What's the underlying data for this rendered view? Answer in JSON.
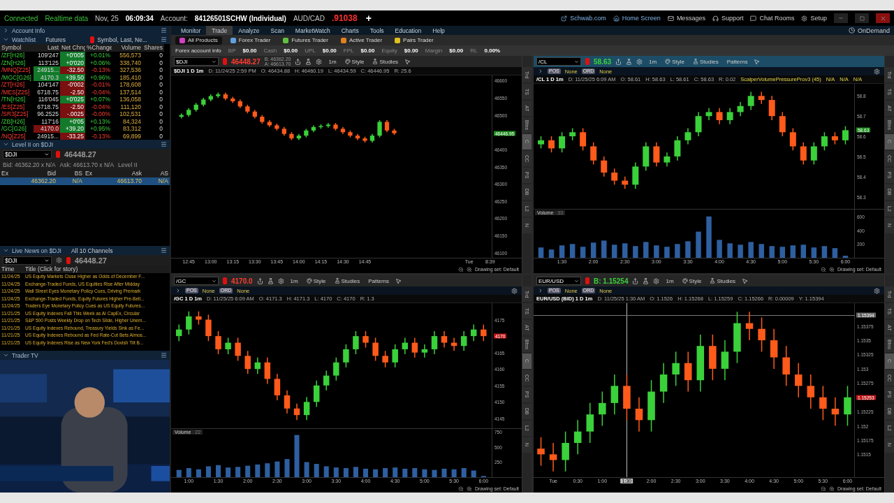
{
  "top_bar": {
    "status": [
      "Connected",
      "Realtime data"
    ],
    "date": "Nov, 25",
    "time": "06:09:34",
    "account_label": "Account:",
    "account": "84126501SCHW (Individual)",
    "symbol": "AUD/CAD",
    "price": ".91038",
    "add": "+",
    "links": [
      {
        "label": "Schwab.com",
        "kind": "external"
      },
      {
        "label": "Home Screen",
        "kind": "home"
      },
      {
        "label": "Messages",
        "kind": "mail"
      },
      {
        "label": "Support",
        "kind": "support"
      },
      {
        "label": "Chat Rooms",
        "kind": "chat"
      },
      {
        "label": "Setup",
        "kind": "setup"
      }
    ]
  },
  "sidebar": {
    "account_header": "Account Info",
    "watchlist": {
      "title": "Watchlist",
      "list": "Futures",
      "columns_menu": "Symbol, Last, Ne...",
      "columns": [
        "Symbol",
        "Last",
        "Net Chng",
        "%Change",
        "Volume",
        "Shares"
      ],
      "rows": [
        {
          "symbol": "/ZF[H26]",
          "last": "109'247",
          "net": "+0'005",
          "pct": "+0.01%",
          "volume": "556,573",
          "shares": "0",
          "rising": true,
          "last_up_tick": false,
          "last_down_tick": false
        },
        {
          "symbol": "/ZN[H26]",
          "last": "113'125",
          "net": "+0'020",
          "pct": "+0.06%",
          "volume": "338,740",
          "shares": "0",
          "rising": true,
          "last_up_tick": false,
          "last_down_tick": false
        },
        {
          "symbol": "/MNQ[Z25]",
          "last": "24915...",
          "net": "-32.50",
          "pct": "-0.13%",
          "volume": "327,536",
          "shares": "0",
          "rising": false,
          "last_up_tick": true,
          "last_down_tick": false
        },
        {
          "symbol": "/MGC[G26]",
          "last": "4170.3",
          "net": "+39.50",
          "pct": "+0.96%",
          "volume": "185,410",
          "shares": "0",
          "rising": true,
          "last_up_tick": true,
          "last_down_tick": false
        },
        {
          "symbol": "/ZT[H26]",
          "last": "104'147",
          "net": "-0'002",
          "pct": "-0.01%",
          "volume": "178,608",
          "shares": "0",
          "rising": false,
          "last_up_tick": false,
          "last_down_tick": false
        },
        {
          "symbol": "/MES[Z25]",
          "last": "6718.75",
          "net": "-2.50",
          "pct": "-0.04%",
          "volume": "137,514",
          "shares": "0",
          "rising": false,
          "last_up_tick": false,
          "last_down_tick": false
        },
        {
          "symbol": "/TN[H26]",
          "last": "116'045",
          "net": "+0'025",
          "pct": "+0.07%",
          "volume": "136,058",
          "shares": "0",
          "rising": true,
          "last_up_tick": false,
          "last_down_tick": false
        },
        {
          "symbol": "/ES[Z25]",
          "last": "6718.75",
          "net": "-2.50",
          "pct": "-0.04%",
          "volume": "111,120",
          "shares": "0",
          "rising": false,
          "last_up_tick": false,
          "last_down_tick": false
        },
        {
          "symbol": "/SR3[Z25]",
          "last": "96.2525",
          "net": "-.0025",
          "pct": "-0.00%",
          "volume": "102,531",
          "shares": "0",
          "rising": false,
          "last_up_tick": false,
          "last_down_tick": false
        },
        {
          "symbol": "/ZB[H26]",
          "last": "117'16",
          "net": "+0'05",
          "pct": "+0.13%",
          "volume": "84,324",
          "shares": "0",
          "rising": true,
          "last_up_tick": false,
          "last_down_tick": false
        },
        {
          "symbol": "/GC[G26]",
          "last": "4170.0",
          "net": "+39.20",
          "pct": "+0.95%",
          "volume": "83,312",
          "shares": "0",
          "rising": true,
          "last_up_tick": false,
          "last_down_tick": true
        },
        {
          "symbol": "/NQ[Z25]",
          "last": "24915...",
          "net": "-33.25",
          "pct": "-0.13%",
          "volume": "69,899",
          "shares": "0",
          "rising": false,
          "last_up_tick": false,
          "last_down_tick": false
        }
      ]
    },
    "level2": {
      "title": "Level II on $DJI",
      "symbol": "$DJI",
      "price": "46448.27",
      "bid": "Bid: 46362.20 x N/A",
      "ask": "Ask: 46613.70 x N/A",
      "mode": "Level II",
      "columns": [
        "Ex",
        "Bid",
        "BS",
        "Ex",
        "Ask",
        "AS"
      ],
      "rows": [
        [
          "",
          "46362.20",
          "N/A",
          "",
          "46613.70",
          "N/A"
        ]
      ]
    },
    "news": {
      "title": "Live News on $DJI",
      "channels": "All 10 Channels",
      "symbol": "$DJI",
      "price": "46448.27",
      "columns": [
        "Time",
        "Title (Click for story)"
      ],
      "rows": [
        [
          "11/24/25",
          "US Equity Markets Close Higher as Odds of December F..."
        ],
        [
          "11/24/25",
          "Exchange-Traded Funds, US Equities Rise After Midday"
        ],
        [
          "11/24/25",
          "Wall Street Eyes Monetary Policy Cues, Driving Premark"
        ],
        [
          "11/24/25",
          "Exchange-Traded Funds, Equity Futures Higher Pre-Bell..."
        ],
        [
          "11/24/25",
          "Traders Eye Monetary Policy Cues as US Equity Futures..."
        ],
        [
          "11/21/25",
          "US Equity Indexes Fall This Week as AI CapEx, Circular"
        ],
        [
          "11/21/25",
          "S&P 500 Posts Weekly Drop on Tech Slide, Higher Unem..."
        ],
        [
          "11/21/25",
          "US Equity Indexes Rebound, Treasury Yields Sink as Fe..."
        ],
        [
          "11/21/25",
          "US Equity Indexes Rebound as Fed Rate-Cut Bets Almos..."
        ],
        [
          "11/21/25",
          "US Equity Indexes Rise as New York Fed's Dovish Tilt B..."
        ]
      ]
    },
    "tv": {
      "title": "Trader TV"
    }
  },
  "menu": {
    "tabs": [
      {
        "label": "Monitor",
        "selected": false
      },
      {
        "label": "Trade",
        "selected": true
      },
      {
        "label": "Analyze",
        "selected": false
      },
      {
        "label": "Scan",
        "selected": false
      },
      {
        "label": "MarketWatch",
        "selected": false
      },
      {
        "label": "Charts",
        "selected": false
      },
      {
        "label": "Tools",
        "selected": false
      },
      {
        "label": "Education",
        "selected": false
      },
      {
        "label": "Help",
        "selected": false
      }
    ],
    "on_demand": "OnDemand"
  },
  "product_tabs": [
    {
      "label": "All Products",
      "selected": true,
      "color": "#d040c0"
    },
    {
      "label": "Forex Trader",
      "selected": false,
      "color": "#60a0e0"
    },
    {
      "label": "Futures Trader",
      "selected": false,
      "color": "#60c040"
    },
    {
      "label": "Active Trader",
      "selected": false,
      "color": "#e08020"
    },
    {
      "label": "Pairs Trader",
      "selected": false,
      "color": "#e0c020"
    }
  ],
  "account_info": {
    "title": "Forex account info",
    "fields": [
      {
        "label": "BP",
        "value": "$0.00"
      },
      {
        "label": "Cash",
        "value": "$0.00"
      },
      {
        "label": "UPL",
        "value": "$0.00"
      },
      {
        "label": "FPL",
        "value": "$0.00"
      },
      {
        "label": "Equity",
        "value": "$0.00"
      },
      {
        "label": "Margin",
        "value": "$0.00"
      },
      {
        "label": "RL",
        "value": "0.00%"
      }
    ]
  },
  "charts": [
    {
      "symbol": "$DJI",
      "price": "46448.27",
      "price_up": false,
      "quote": [
        "B: 46362.20",
        "A: 46613.70"
      ],
      "active": false,
      "buttons": [
        "1m",
        "Style",
        "Studies"
      ],
      "info": {
        "title": "$DJI 1 D 1m",
        "fields": [
          "D: 11/24/25 2:59 PM",
          "O: 46434.88",
          "H: 46460.19",
          "L: 46434.59",
          "C: 46446.95",
          "R: 25.6"
        ]
      },
      "badge_up": true,
      "chart_data": {
        "type": "candlestick",
        "x": [
          12.667,
          12.75,
          12.833,
          12.917,
          13,
          13.083,
          13.167,
          13.25,
          13.333,
          13.417,
          13.5,
          13.583,
          13.667,
          13.75,
          13.833,
          13.917,
          14,
          14.083,
          14.167,
          14.25,
          14.333,
          14.417,
          14.5,
          14.583,
          14.667,
          14.75,
          14.833,
          14.917,
          15,
          15.083
        ],
        "ohlc": [
          [
            46495,
            46505,
            46490,
            46500
          ],
          [
            46500,
            46520,
            46495,
            46515
          ],
          [
            46515,
            46535,
            46510,
            46530
          ],
          [
            46530,
            46550,
            46525,
            46545
          ],
          [
            46545,
            46560,
            46540,
            46555
          ],
          [
            46555,
            46565,
            46550,
            46560
          ],
          [
            46560,
            46565,
            46543,
            46548
          ],
          [
            46548,
            46553,
            46535,
            46540
          ],
          [
            46540,
            46545,
            46520,
            46525
          ],
          [
            46525,
            46530,
            46505,
            46510
          ],
          [
            46510,
            46515,
            46490,
            46495
          ],
          [
            46495,
            46500,
            46475,
            46480
          ],
          [
            46480,
            46485,
            46465,
            46470
          ],
          [
            46470,
            46475,
            46455,
            46460
          ],
          [
            46460,
            46465,
            46440,
            46445
          ],
          [
            46445,
            46450,
            46427,
            46432
          ],
          [
            46432,
            46445,
            46427,
            46440
          ],
          [
            46440,
            46460,
            46435,
            46455
          ],
          [
            46455,
            46470,
            46450,
            46465
          ],
          [
            46465,
            46473,
            46460,
            46468
          ],
          [
            46468,
            46477,
            46463,
            46472
          ],
          [
            46472,
            46477,
            46455,
            46460
          ],
          [
            46460,
            46465,
            46445,
            46450
          ],
          [
            46450,
            46455,
            46435,
            46440
          ],
          [
            46440,
            46445,
            46427,
            46432
          ],
          [
            46432,
            46437,
            46420,
            46425
          ],
          [
            46425,
            46445,
            46420,
            46440
          ],
          [
            46440,
            46485,
            46435,
            46480
          ],
          [
            46480,
            46485,
            46450,
            46455
          ],
          [
            46455,
            46460,
            46442,
            46447
          ]
        ],
        "xlim": [
          12.55,
          16.53
        ],
        "ylim": [
          46085,
          46615
        ],
        "xticks": [
          {
            "value": 12.75,
            "label": "12:45"
          },
          {
            "value": 13,
            "label": "13:00"
          },
          {
            "value": 13.25,
            "label": "13:15"
          },
          {
            "value": 13.5,
            "label": "13:30"
          },
          {
            "value": 13.75,
            "label": "13:45"
          },
          {
            "value": 14,
            "label": "14:00"
          },
          {
            "value": 14.25,
            "label": "14:15"
          },
          {
            "value": 14.5,
            "label": "14:30"
          },
          {
            "value": 14.75,
            "label": "14:45"
          }
        ],
        "yticks": [
          46600,
          46550,
          46500,
          46400,
          46350,
          46300,
          46250,
          46200,
          46150,
          46100
        ],
        "annotations": [
          "46446.95"
        ]
      },
      "x_extra_labels": [
        "Tue",
        "8:39"
      ],
      "side_tabs": [
        {
          "label": "Trd",
          "selected": false
        },
        {
          "label": "TS",
          "selected": false
        },
        {
          "label": "AT",
          "selected": false
        },
        {
          "label": "Btns",
          "selected": false
        },
        {
          "label": "C",
          "selected": true
        },
        {
          "label": "CC",
          "selected": false
        },
        {
          "label": "PS",
          "selected": false
        },
        {
          "label": "DB",
          "selected": false
        },
        {
          "label": "L2",
          "selected": false
        },
        {
          "label": "N",
          "selected": false
        }
      ],
      "drawing_set": "Drawing set: Default"
    },
    {
      "symbol": "/CL",
      "price": "58.63",
      "price_up": true,
      "active": true,
      "buttons": [
        "1m",
        "Style",
        "Studies",
        "Patterns"
      ],
      "studies_row": [
        {
          "tag": "POS",
          "value": "None"
        },
        {
          "tag": "ORD",
          "value": "None"
        }
      ],
      "info": {
        "title": "/CL 1 D 1m",
        "fields": [
          "D: 11/25/25 6:09 AM",
          "O: 58.61",
          "H: 58.63",
          "L: 58.61",
          "C: 58.63",
          "R: 0.02"
        ],
        "study": "ScalperVolumePressureProv3 (45)",
        "study_values": [
          "N/A",
          "N/A",
          "N/A"
        ]
      },
      "badge_up": true,
      "chart_data": {
        "type": "candlestick",
        "x": [
          1.167,
          1.333,
          1.5,
          1.667,
          1.833,
          2,
          2.167,
          2.333,
          2.5,
          2.667,
          2.833,
          3,
          3.167,
          3.333,
          3.5,
          3.667,
          3.833,
          4,
          4.167,
          4.333,
          4.5,
          4.667,
          4.833,
          5,
          5.167,
          5.333,
          5.5,
          5.667,
          5.833,
          6
        ],
        "ohlc": [
          [
            58.56,
            58.6,
            58.54,
            58.58
          ],
          [
            58.58,
            58.6,
            58.52,
            58.54
          ],
          [
            58.54,
            58.62,
            58.52,
            58.6
          ],
          [
            58.6,
            58.64,
            58.58,
            58.62
          ],
          [
            58.62,
            58.64,
            58.53,
            58.55
          ],
          [
            58.55,
            58.57,
            58.46,
            58.48
          ],
          [
            58.48,
            58.5,
            58.4,
            58.42
          ],
          [
            58.42,
            58.44,
            58.36,
            58.38
          ],
          [
            58.38,
            58.4,
            58.34,
            58.36
          ],
          [
            58.36,
            58.47,
            58.34,
            58.45
          ],
          [
            58.45,
            58.57,
            58.43,
            58.55
          ],
          [
            58.55,
            58.57,
            58.45,
            58.47
          ],
          [
            58.47,
            58.52,
            58.45,
            58.5
          ],
          [
            58.5,
            58.6,
            58.48,
            58.58
          ],
          [
            58.58,
            58.64,
            58.56,
            58.62
          ],
          [
            58.62,
            58.72,
            58.6,
            58.7
          ],
          [
            58.7,
            58.74,
            58.68,
            58.72
          ],
          [
            58.72,
            58.74,
            58.66,
            58.68
          ],
          [
            58.68,
            58.74,
            58.66,
            58.72
          ],
          [
            58.72,
            58.77,
            58.7,
            58.75
          ],
          [
            58.75,
            58.82,
            58.73,
            58.8
          ],
          [
            58.8,
            58.82,
            58.76,
            58.78
          ],
          [
            58.78,
            58.8,
            58.68,
            58.7
          ],
          [
            58.7,
            58.72,
            58.6,
            58.62
          ],
          [
            58.62,
            58.64,
            58.53,
            58.55
          ],
          [
            58.55,
            58.57,
            58.46,
            58.48
          ],
          [
            58.48,
            58.57,
            58.46,
            58.55
          ],
          [
            58.55,
            58.62,
            58.53,
            58.6
          ],
          [
            58.6,
            58.62,
            58.56,
            58.58
          ],
          [
            58.58,
            58.65,
            58.56,
            58.63
          ]
        ],
        "xlim": [
          1.05,
          6.616
        ],
        "ylim": [
          58.24,
          58.86
        ],
        "yticks": [
          58.8,
          58.7,
          58.6,
          58.5,
          58.4,
          58.3
        ],
        "annotations": [
          "58.63"
        ]
      },
      "volume": {
        "value": "33",
        "chart_data": {
          "type": "bar",
          "title": "Volume",
          "x": [
            1.167,
            1.333,
            1.5,
            1.667,
            1.833,
            2,
            2.167,
            2.333,
            2.5,
            2.667,
            2.833,
            3,
            3.167,
            3.333,
            3.5,
            3.667,
            3.833,
            4,
            4.167,
            4.333,
            4.5,
            4.667,
            4.833,
            5,
            5.167,
            5.333,
            5.5,
            5.667,
            5.833,
            6
          ],
          "values": [
            150,
            120,
            180,
            200,
            160,
            220,
            250,
            190,
            210,
            170,
            230,
            180,
            160,
            200,
            240,
            380,
            600,
            260,
            210,
            190,
            230,
            200,
            170,
            160,
            180,
            190,
            150,
            170,
            140,
            30
          ],
          "xlim": [
            1.05,
            6.616
          ],
          "ylim": [
            0,
            700
          ],
          "yticks": [
            600,
            400,
            200
          ],
          "xticks": [
            {
              "value": 1.5,
              "label": "1:30"
            },
            {
              "value": 2,
              "label": "2:00"
            },
            {
              "value": 2.5,
              "label": "2:30"
            },
            {
              "value": 3,
              "label": "3:00"
            },
            {
              "value": 3.5,
              "label": "3:30"
            },
            {
              "value": 4,
              "label": "4:00"
            },
            {
              "value": 4.5,
              "label": "4:30"
            },
            {
              "value": 5,
              "label": "5:00"
            },
            {
              "value": 5.5,
              "label": "5:30"
            },
            {
              "value": 6,
              "label": "6:00"
            }
          ]
        }
      },
      "side_tabs": [
        {
          "label": "Trd",
          "selected": false
        },
        {
          "label": "TS",
          "selected": false
        },
        {
          "label": "AT",
          "selected": false
        },
        {
          "label": "Btns",
          "selected": false
        },
        {
          "label": "C",
          "selected": true
        },
        {
          "label": "CC",
          "selected": false
        },
        {
          "label": "PS",
          "selected": false
        },
        {
          "label": "DB",
          "selected": false
        },
        {
          "label": "L2",
          "selected": false
        },
        {
          "label": "N",
          "selected": false
        }
      ],
      "drawing_set": "Drawing set: Default"
    },
    {
      "symbol": "/GC",
      "price": "4170.0",
      "price_up": false,
      "active": false,
      "buttons": [
        "1m",
        "Style",
        "Studies",
        "Patterns"
      ],
      "studies_row": [
        {
          "tag": "POS",
          "value": "None"
        },
        {
          "tag": "ORD",
          "value": "None"
        }
      ],
      "info": {
        "title": "/GC 1 D 1m",
        "fields": [
          "D: 11/25/25 6:09 AM",
          "O: 4171.3",
          "H: 4171.3",
          "L: 4170",
          "C: 4170",
          "R: 1.3"
        ]
      },
      "badge_up": false,
      "chart_data": {
        "type": "candlestick",
        "x": [
          0.833,
          1,
          1.167,
          1.333,
          1.5,
          1.667,
          1.833,
          2,
          2.167,
          2.333,
          2.5,
          2.667,
          2.833,
          3,
          3.167,
          3.333,
          3.5,
          3.667,
          3.833,
          4,
          4.167,
          4.333,
          4.5,
          4.667,
          4.833,
          5,
          5.167,
          5.333,
          5.5,
          5.667,
          5.833,
          6
        ],
        "ohlc": [
          [
            4170,
            4173.5,
            4168.5,
            4172
          ],
          [
            4172,
            4177.5,
            4170.5,
            4176
          ],
          [
            4176,
            4177.5,
            4173.5,
            4175
          ],
          [
            4175,
            4176.5,
            4168.5,
            4170
          ],
          [
            4170,
            4171.5,
            4164.5,
            4166
          ],
          [
            4166,
            4169.5,
            4164.5,
            4168
          ],
          [
            4168,
            4169.5,
            4162.5,
            4164
          ],
          [
            4164,
            4165.5,
            4158.5,
            4160
          ],
          [
            4160,
            4163.5,
            4158.5,
            4162
          ],
          [
            4162,
            4163.5,
            4155.5,
            4157
          ],
          [
            4157,
            4158.5,
            4150.5,
            4152
          ],
          [
            4152,
            4153.5,
            4146.5,
            4148
          ],
          [
            4148,
            4149.5,
            4144.5,
            4146
          ],
          [
            4146,
            4151.5,
            4144.5,
            4150
          ],
          [
            4150,
            4156.5,
            4148.5,
            4155
          ],
          [
            4155,
            4159.5,
            4153.5,
            4158
          ],
          [
            4158,
            4163.5,
            4156.5,
            4162
          ],
          [
            4162,
            4167.5,
            4160.5,
            4166
          ],
          [
            4166,
            4171.5,
            4164.5,
            4170
          ],
          [
            4170,
            4171.5,
            4166.5,
            4168
          ],
          [
            4168,
            4169.5,
            4162.5,
            4164
          ],
          [
            4164,
            4165.5,
            4160.5,
            4162
          ],
          [
            4162,
            4167.5,
            4160.5,
            4166
          ],
          [
            4166,
            4169.5,
            4164.5,
            4168
          ],
          [
            4168,
            4169.5,
            4163.5,
            4165
          ],
          [
            4165,
            4167.5,
            4163.5,
            4166
          ],
          [
            4166,
            4171.5,
            4164.5,
            4170
          ],
          [
            4170,
            4171.5,
            4166.5,
            4168
          ],
          [
            4168,
            4169.5,
            4165.5,
            4167
          ],
          [
            4167,
            4171.5,
            4165.5,
            4170
          ],
          [
            4170,
            4173.5,
            4168.5,
            4172
          ],
          [
            4172,
            4173.5,
            4168.5,
            4170
          ]
        ],
        "xlim": [
          0.7,
          6.648
        ],
        "ylim": [
          4142,
          4180
        ],
        "yticks": [
          4175,
          4165,
          4160,
          4155,
          4150,
          4145
        ],
        "annotations": [
          "4170"
        ]
      },
      "volume": {
        "value": "22",
        "chart_data": {
          "type": "bar",
          "title": "Volume",
          "x": [
            0.833,
            1,
            1.167,
            1.333,
            1.5,
            1.667,
            1.833,
            2,
            2.167,
            2.333,
            2.5,
            2.667,
            2.833,
            3,
            3.167,
            3.333,
            3.5,
            3.667,
            3.833,
            4,
            4.167,
            4.333,
            4.5,
            4.667,
            4.833,
            5,
            5.167,
            5.333,
            5.5,
            5.667,
            5.833,
            6
          ],
          "values": [
            120,
            150,
            130,
            180,
            200,
            160,
            170,
            190,
            210,
            230,
            260,
            300,
            700,
            250,
            220,
            180,
            160,
            150,
            170,
            140,
            130,
            150,
            160,
            140,
            150,
            130,
            120,
            140,
            130,
            150,
            110,
            20
          ],
          "xlim": [
            0.7,
            6.648
          ],
          "ylim": [
            0,
            800
          ],
          "yticks": [
            750,
            500,
            250
          ],
          "xticks": [
            {
              "value": 1,
              "label": "1:00"
            },
            {
              "value": 1.5,
              "label": "1:30"
            },
            {
              "value": 2,
              "label": "2:00"
            },
            {
              "value": 2.5,
              "label": "2:30"
            },
            {
              "value": 3,
              "label": "3:00"
            },
            {
              "value": 3.5,
              "label": "3:30"
            },
            {
              "value": 4,
              "label": "4:00"
            },
            {
              "value": 4.5,
              "label": "4:30"
            },
            {
              "value": 5,
              "label": "5:00"
            },
            {
              "value": 5.5,
              "label": "5:30"
            },
            {
              "value": 6,
              "label": "6:00"
            }
          ]
        }
      },
      "side_tabs": [
        {
          "label": "Trd",
          "selected": false
        },
        {
          "label": "TS",
          "selected": false
        },
        {
          "label": "AT",
          "selected": false
        },
        {
          "label": "Btns",
          "selected": false
        },
        {
          "label": "C",
          "selected": true
        },
        {
          "label": "CC",
          "selected": false
        },
        {
          "label": "PS",
          "selected": false
        },
        {
          "label": "DB",
          "selected": false
        },
        {
          "label": "L2",
          "selected": false
        },
        {
          "label": "N",
          "selected": false
        }
      ],
      "drawing_set": "Drawing set: Default"
    },
    {
      "symbol": "EUR/USD",
      "price": "B: 1.15254",
      "price_up": true,
      "active": false,
      "buttons": [
        "1m",
        "Style",
        "Studies"
      ],
      "studies_row": [
        {
          "tag": "POS",
          "value": "None"
        },
        {
          "tag": "ORD",
          "value": "None"
        }
      ],
      "info": {
        "title": "EUR/USD (BID) 1 D 1m",
        "fields": [
          "D: 11/25/25 1:30 AM",
          "O: 1.1526",
          "H: 1.15268",
          "L: 1.15259",
          "C: 1.15266",
          "R: 0.00009",
          "Y: 1.15394"
        ]
      },
      "badge_up": false,
      "crosshair": {
        "price": "1.15394"
      },
      "chart_data": {
        "type": "candlestick",
        "x": [
          -0.25,
          0,
          0.25,
          0.5,
          0.75,
          1,
          1.25,
          1.5,
          1.75,
          2,
          2.25,
          2.5,
          2.75,
          3,
          3.25,
          3.5,
          3.75,
          4,
          4.25,
          4.5,
          4.75,
          5,
          5.25,
          5.5,
          5.75,
          6
        ],
        "ohlc": [
          [
            1.1516,
            1.1518,
            1.1513,
            1.1515
          ],
          [
            1.1515,
            1.1517,
            1.1512,
            1.1514
          ],
          [
            1.1514,
            1.1519,
            1.1512,
            1.1517
          ],
          [
            1.1517,
            1.1521,
            1.1515,
            1.1519
          ],
          [
            1.1519,
            1.1524,
            1.1517,
            1.1522
          ],
          [
            1.1522,
            1.1526,
            1.152,
            1.1524
          ],
          [
            1.1524,
            1.1529,
            1.1522,
            1.1527
          ],
          [
            1.1527,
            1.1529,
            1.1521,
            1.1523
          ],
          [
            1.1523,
            1.1525,
            1.1519,
            1.1521
          ],
          [
            1.1521,
            1.1528,
            1.1519,
            1.1526
          ],
          [
            1.1526,
            1.1531,
            1.1524,
            1.1529
          ],
          [
            1.1529,
            1.1533,
            1.1527,
            1.1531
          ],
          [
            1.1531,
            1.1533,
            1.1526,
            1.1528
          ],
          [
            1.1528,
            1.1536,
            1.1526,
            1.1534
          ],
          [
            1.1534,
            1.1536,
            1.1528,
            1.153
          ],
          [
            1.153,
            1.1535,
            1.1528,
            1.1533
          ],
          [
            1.1533,
            1.154,
            1.1531,
            1.1538
          ],
          [
            1.1538,
            1.154,
            1.1535,
            1.1537
          ],
          [
            1.1537,
            1.1539,
            1.1533,
            1.1535
          ],
          [
            1.1535,
            1.1537,
            1.153,
            1.1532
          ],
          [
            1.1532,
            1.1534,
            1.1527,
            1.1529
          ],
          [
            1.1529,
            1.1531,
            1.1525,
            1.1527
          ],
          [
            1.1527,
            1.1529,
            1.1523,
            1.1525
          ],
          [
            1.1525,
            1.1527,
            1.1521,
            1.1523
          ],
          [
            1.1523,
            1.1525,
            1.152,
            1.1522
          ],
          [
            1.1522,
            1.1527,
            1.152,
            1.1525
          ]
        ],
        "xlim": [
          -0.4,
          6.748
        ],
        "ylim": [
          1.1511,
          1.15415
        ],
        "ref_lines": [
          {
            "axis": "x",
            "value": 1.5
          },
          {
            "axis": "y",
            "value": 1.15394
          }
        ],
        "xticks": [
          {
            "value": 0,
            "label": "Tue"
          },
          {
            "value": 0.5,
            "label": "0:30"
          },
          {
            "value": 1,
            "label": "1:00"
          },
          {
            "value": 1.5,
            "label": "1:30"
          },
          {
            "value": 2,
            "label": "2:00"
          },
          {
            "value": 2.5,
            "label": "2:30"
          },
          {
            "value": 3,
            "label": "3:00"
          },
          {
            "value": 3.5,
            "label": "3:30"
          },
          {
            "value": 4,
            "label": "4:00"
          },
          {
            "value": 4.5,
            "label": "4:30"
          },
          {
            "value": 5,
            "label": "5:00"
          },
          {
            "value": 5.5,
            "label": "5:30"
          },
          {
            "value": 6,
            "label": "6:00"
          }
        ],
        "yticks": [
          1.15375,
          1.1535,
          1.15325,
          1.153,
          1.15275,
          1.15225,
          1.152,
          1.15175,
          1.1515
        ],
        "annotations": [
          "1.15253"
        ]
      },
      "side_tabs": [
        {
          "label": "Trd",
          "selected": false
        },
        {
          "label": "TS",
          "selected": false
        },
        {
          "label": "AT",
          "selected": false
        },
        {
          "label": "Btns",
          "selected": false
        },
        {
          "label": "C",
          "selected": true
        },
        {
          "label": "CC",
          "selected": false
        },
        {
          "label": "PS",
          "selected": false
        },
        {
          "label": "DB",
          "selected": false
        },
        {
          "label": "L2",
          "selected": false
        },
        {
          "label": "N",
          "selected": false
        }
      ],
      "drawing_set": "Drawing set: Default"
    }
  ]
}
